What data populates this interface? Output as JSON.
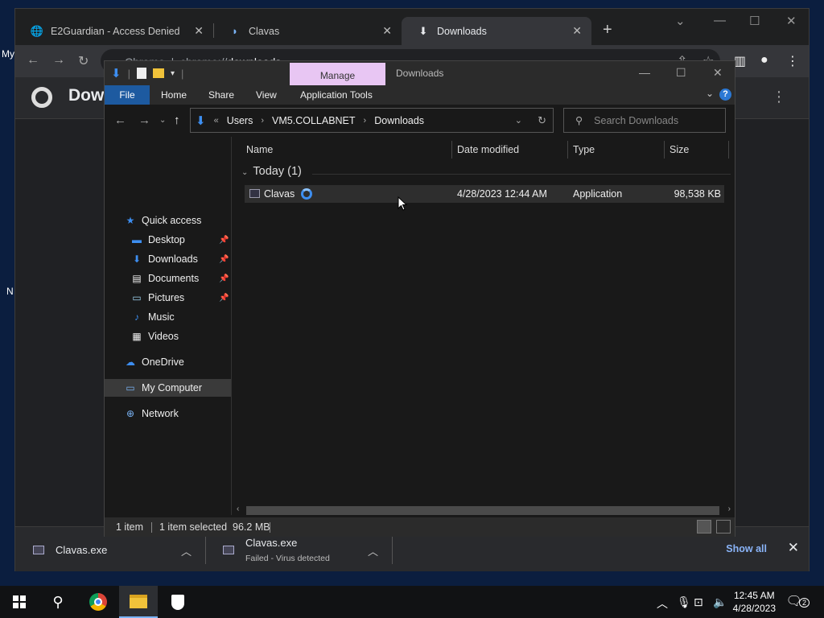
{
  "desktop": {
    "edge_label_top": "My",
    "edge_label_mid": "N"
  },
  "chrome": {
    "tabs": [
      {
        "label": "E2Guardian - Access Denied",
        "icon": "globe-icon"
      },
      {
        "label": "Clavas",
        "icon": "clavas-icon"
      },
      {
        "label": "Downloads",
        "icon": "download-icon"
      }
    ],
    "omnibox": {
      "site": "Chrome",
      "url_prefix": "chrome://",
      "url_path": "downloads"
    },
    "page_title": "Dow",
    "shelf": {
      "items": [
        {
          "name": "Clavas.exe",
          "status": ""
        },
        {
          "name": "Clavas.exe",
          "status": "Failed - Virus detected"
        }
      ],
      "show_all": "Show all"
    }
  },
  "explorer": {
    "manage_tab": "Manage",
    "title": "Downloads",
    "ribbon_tabs": [
      "File",
      "Home",
      "Share",
      "View",
      "Application Tools"
    ],
    "address": {
      "crumbs": [
        "Users",
        "VM5.COLLABNET",
        "Downloads"
      ]
    },
    "search_placeholder": "Search Downloads",
    "nav": [
      {
        "label": "Quick access",
        "icon": "star-icon"
      },
      {
        "label": "Desktop",
        "icon": "desktop-icon",
        "pinned": true
      },
      {
        "label": "Downloads",
        "icon": "download-icon",
        "pinned": true
      },
      {
        "label": "Documents",
        "icon": "documents-icon",
        "pinned": true
      },
      {
        "label": "Pictures",
        "icon": "pictures-icon",
        "pinned": true
      },
      {
        "label": "Music",
        "icon": "music-icon"
      },
      {
        "label": "Videos",
        "icon": "videos-icon"
      },
      {
        "label": "OneDrive",
        "icon": "cloud-icon"
      },
      {
        "label": "My Computer",
        "icon": "computer-icon"
      },
      {
        "label": "Network",
        "icon": "network-icon"
      }
    ],
    "columns": [
      "Name",
      "Date modified",
      "Type",
      "Size"
    ],
    "group": "Today (1)",
    "files": [
      {
        "name": "Clavas",
        "date": "4/28/2023 12:44 AM",
        "type": "Application",
        "size": "98,538 KB"
      }
    ],
    "status": {
      "count": "1 item",
      "selected": "1 item selected  96.2 MB"
    }
  },
  "taskbar": {
    "time": "12:45 AM",
    "date": "4/28/2023",
    "notifications": "2"
  }
}
